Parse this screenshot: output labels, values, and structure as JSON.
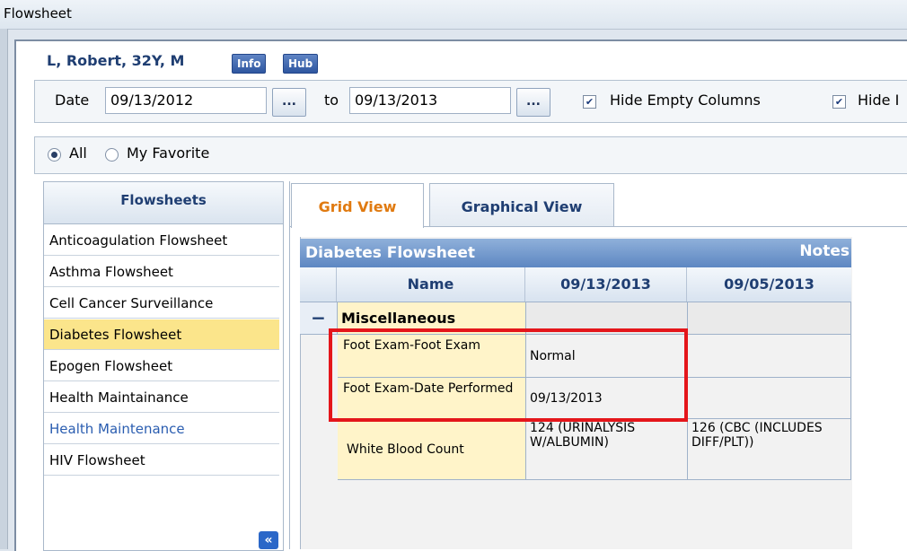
{
  "window": {
    "title": "Flowsheet"
  },
  "patient": {
    "name": "L, Robert, 32Y, M",
    "info_label": "Info",
    "hub_label": "Hub"
  },
  "date_filter": {
    "date_label": "Date",
    "from_value": "09/13/2012",
    "to_label": "to",
    "to_value": "09/13/2013",
    "picker_label": "...",
    "hide_empty_columns": {
      "label": "Hide Empty Columns",
      "checked": true
    },
    "hide_second": {
      "label": "Hide I",
      "checked": true
    }
  },
  "filter": {
    "all_label": "All",
    "favorite_label": "My Favorite",
    "selected": "All"
  },
  "sidebar": {
    "header": "Flowsheets",
    "items": [
      {
        "label": "Anticoagulation Flowsheet"
      },
      {
        "label": "Asthma Flowsheet"
      },
      {
        "label": "Cell Cancer Surveillance"
      },
      {
        "label": "Diabetes Flowsheet"
      },
      {
        "label": "Epogen Flowsheet"
      },
      {
        "label": "Health Maintainance"
      },
      {
        "label": "Health Maintenance"
      },
      {
        "label": "HIV Flowsheet"
      }
    ],
    "collapse_label": "«"
  },
  "tabs": [
    {
      "label": "Grid View"
    },
    {
      "label": "Graphical View"
    }
  ],
  "grid": {
    "title": "Diabetes Flowsheet",
    "notes_label": "Notes",
    "columns": [
      "Name",
      "09/13/2013",
      "09/05/2013"
    ],
    "group": {
      "toggle": "−",
      "label": "Miscellaneous"
    },
    "rows": [
      {
        "name": "Foot Exam-Foot Exam",
        "c1": "Normal",
        "c2": ""
      },
      {
        "name": "Foot Exam-Date Performed",
        "c1": "09/13/2013",
        "c2": ""
      },
      {
        "name": "White Blood Count",
        "c1": "124 (URINALYSIS W/ALBUMIN)",
        "c2": "126 (CBC (INCLUDES DIFF/PLT))"
      }
    ]
  },
  "colors": {
    "accent": "#1f3e72",
    "selected": "#fbe58b",
    "tab_active": "#e07a10",
    "highlight": "#e4161b"
  }
}
